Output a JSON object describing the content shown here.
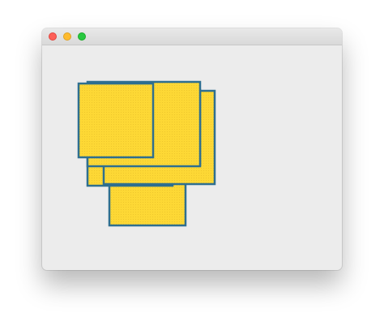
{
  "window": {
    "title": "",
    "controls": [
      "close",
      "minimize",
      "maximize"
    ]
  },
  "colors": {
    "square_fill": "#fdd835",
    "square_stroke": "#2f6f8f",
    "window_bg": "#ececec"
  },
  "shapes": {
    "count": 6,
    "kind": "overlapping squares"
  }
}
